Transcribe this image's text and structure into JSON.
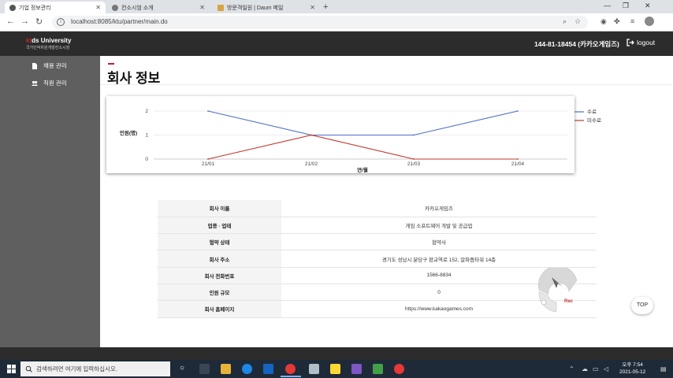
{
  "browser": {
    "tabs": [
      {
        "title": "기업 정보관리",
        "active": true
      },
      {
        "title": "컨소시엄 소개",
        "active": false
      },
      {
        "title": "방문객일원 | Daum 메일",
        "active": false
      }
    ],
    "new_tab_label": "+",
    "url": "localhost:8085/ktu/partner/main.do"
  },
  "header": {
    "logo_mark_ko": "kt",
    "logo_mark_ds": "ds",
    "logo_title": "University",
    "logo_subtitle": "국가인적자원개발컨소시엄",
    "company_id": "144-81-18454 (카카오게임즈)",
    "logout_label": "logout"
  },
  "sidebar": {
    "items": [
      {
        "label": "채용 관리",
        "icon": "document-icon"
      },
      {
        "label": "직원 관리",
        "icon": "users-icon"
      }
    ]
  },
  "main": {
    "title": "회사 정보"
  },
  "chart_data": {
    "type": "line",
    "categories": [
      "21/01",
      "21/02",
      "21/03",
      "21/04"
    ],
    "series": [
      {
        "name": "수료",
        "values": [
          2,
          1,
          1,
          2
        ],
        "color": "#4e6fc4"
      },
      {
        "name": "미수료",
        "values": [
          0,
          1,
          0,
          0
        ],
        "color": "#c0392b"
      }
    ],
    "xlabel": "연/월",
    "ylabel": "인원(명)",
    "yticks": [
      0,
      1,
      2
    ],
    "ylim": [
      0,
      2
    ],
    "legend": "top-right",
    "grid": true
  },
  "company_info": {
    "rows": [
      {
        "label": "회사 이름",
        "value": "카카오게임즈"
      },
      {
        "label": "업종 · 업태",
        "value": "게임 소프트웨어 개발 및 공급업"
      },
      {
        "label": "협약 상태",
        "value": "협약사"
      },
      {
        "label": "회사 주소",
        "value": "경기도 성남시 분당구 판교역로 152, 알파돔타워 14층"
      },
      {
        "label": "회사 전화번호",
        "value": "1566-8834"
      },
      {
        "label": "인원 규모",
        "value": "0"
      },
      {
        "label": "회사 홈페이지",
        "value": "https://www.kakaogames.com"
      }
    ]
  },
  "widget": {
    "rec_label": "Rec"
  },
  "top_button_label": "TOP",
  "taskbar": {
    "search_placeholder": "검색하려면 여기에 입력하십시오.",
    "time": "오후 7:54",
    "date": "2021-05-12"
  }
}
